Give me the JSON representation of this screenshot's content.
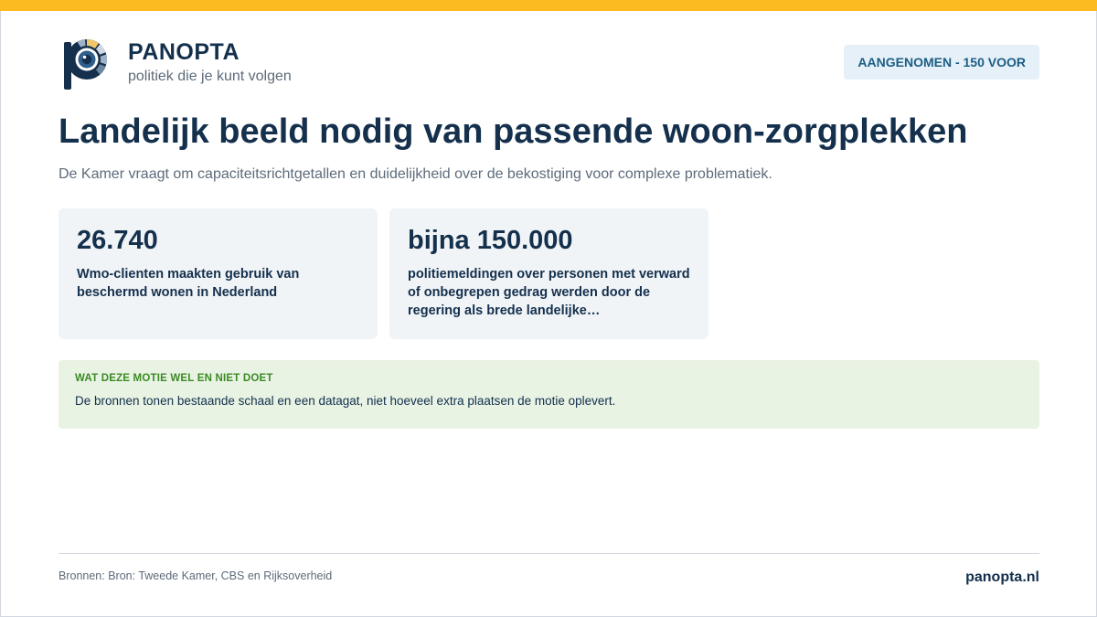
{
  "brand": {
    "name": "PANOPTA",
    "tagline": "politiek die je kunt volgen",
    "logo_icon": "panopta-eye-logo-icon"
  },
  "status": {
    "label": "AANGENOMEN - 150 VOOR"
  },
  "main": {
    "title": "Landelijk beeld nodig van passende woon-zorgplekken",
    "subtitle": "De Kamer vraagt om capaciteitsrichtgetallen en duidelijkheid over de bekostiging voor complexe problematiek."
  },
  "stats": [
    {
      "value": "26.740",
      "description": "Wmo-clienten maakten gebruik van beschermd wonen in Nederland"
    },
    {
      "value": "bijna 150.000",
      "description": "politiemeldingen over personen met verward of onbegrepen gedrag werden door de regering als brede landelijke…"
    }
  ],
  "note": {
    "title": "WAT DEZE MOTIE WEL EN NIET DOET",
    "body": "De bronnen tonen bestaande schaal en een datagat, niet hoeveel extra plaatsen de motie oplevert."
  },
  "footer": {
    "sources": "Bronnen: Bron: Tweede Kamer, CBS en Rijksoverheid",
    "site": "panopta.nl"
  },
  "colors": {
    "accent_bar": "#fbbb21",
    "navy": "#14304d",
    "badge_bg": "#e5f0f8",
    "badge_text": "#1b5d85",
    "note_bg": "#e8f3e4",
    "note_title": "#3b8a23"
  }
}
